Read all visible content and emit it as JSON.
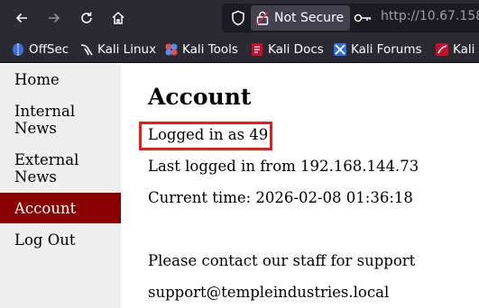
{
  "browser": {
    "security_label": "Not Secure",
    "url": "http://10.67.158"
  },
  "bookmarks": [
    {
      "label": "OffSec",
      "icon": "offsec-icon"
    },
    {
      "label": "Kali Linux",
      "icon": "kali-dragon-icon"
    },
    {
      "label": "Kali Tools",
      "icon": "kali-tools-icon"
    },
    {
      "label": "Kali Docs",
      "icon": "kali-docs-icon"
    },
    {
      "label": "Kali Forums",
      "icon": "kali-forums-icon"
    },
    {
      "label": "Kali N",
      "icon": "kali-nethunter-icon"
    }
  ],
  "sidebar": {
    "items": [
      {
        "label": "Home"
      },
      {
        "label": "Internal News"
      },
      {
        "label": "External News"
      },
      {
        "label": "Account",
        "active": true
      },
      {
        "label": "Log Out"
      }
    ],
    "active_color": "#8b0000"
  },
  "main": {
    "title": "Account",
    "logged_in": "Logged in as 49",
    "last_login": "Last logged in from 192.168.144.73",
    "current_time": "Current time: 2026-02-08 01:36:18",
    "contact": "Please contact our staff for support",
    "email": "support@templeindustries.local"
  },
  "highlight_color": "#e0201a"
}
